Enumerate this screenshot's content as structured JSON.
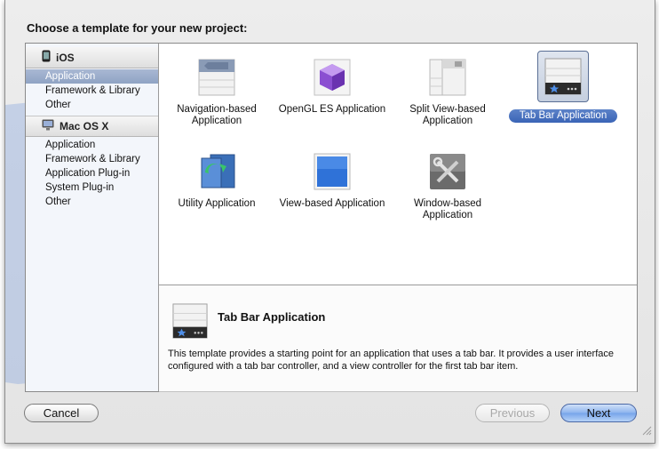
{
  "heading": "Choose a template for your new project:",
  "sidebar": {
    "groups": [
      {
        "label": "iOS",
        "icon": "iphone-icon",
        "items": [
          "Application",
          "Framework & Library",
          "Other"
        ]
      },
      {
        "label": "Mac OS X",
        "icon": "mac-os-x-icon",
        "items": [
          "Application",
          "Framework & Library",
          "Application Plug-in",
          "System Plug-in",
          "Other"
        ]
      }
    ],
    "selected": {
      "group": 0,
      "item": 0
    }
  },
  "templates": [
    {
      "label": "Navigation-based Application",
      "icon": "navigation-icon"
    },
    {
      "label": "OpenGL ES Application",
      "icon": "opengl-cube-icon"
    },
    {
      "label": "Split View-based Application",
      "icon": "split-view-icon"
    },
    {
      "label": "Tab Bar Application",
      "icon": "tab-bar-icon",
      "selected": true
    },
    {
      "label": "Utility Application",
      "icon": "utility-icon"
    },
    {
      "label": "View-based Application",
      "icon": "view-icon"
    },
    {
      "label": "Window-based Application",
      "icon": "tools-icon"
    }
  ],
  "description": {
    "title": "Tab Bar Application",
    "text": "This template provides a starting point for an application that uses a tab bar. It provides a user interface configured with a tab bar controller, and a view controller for the first tab bar item."
  },
  "buttons": {
    "cancel": "Cancel",
    "previous": "Previous",
    "next": "Next"
  },
  "colors": {
    "selection": "#3a64b6",
    "next_button": "#76a4ea",
    "backdrop_blueprint": "#6f95d9"
  }
}
